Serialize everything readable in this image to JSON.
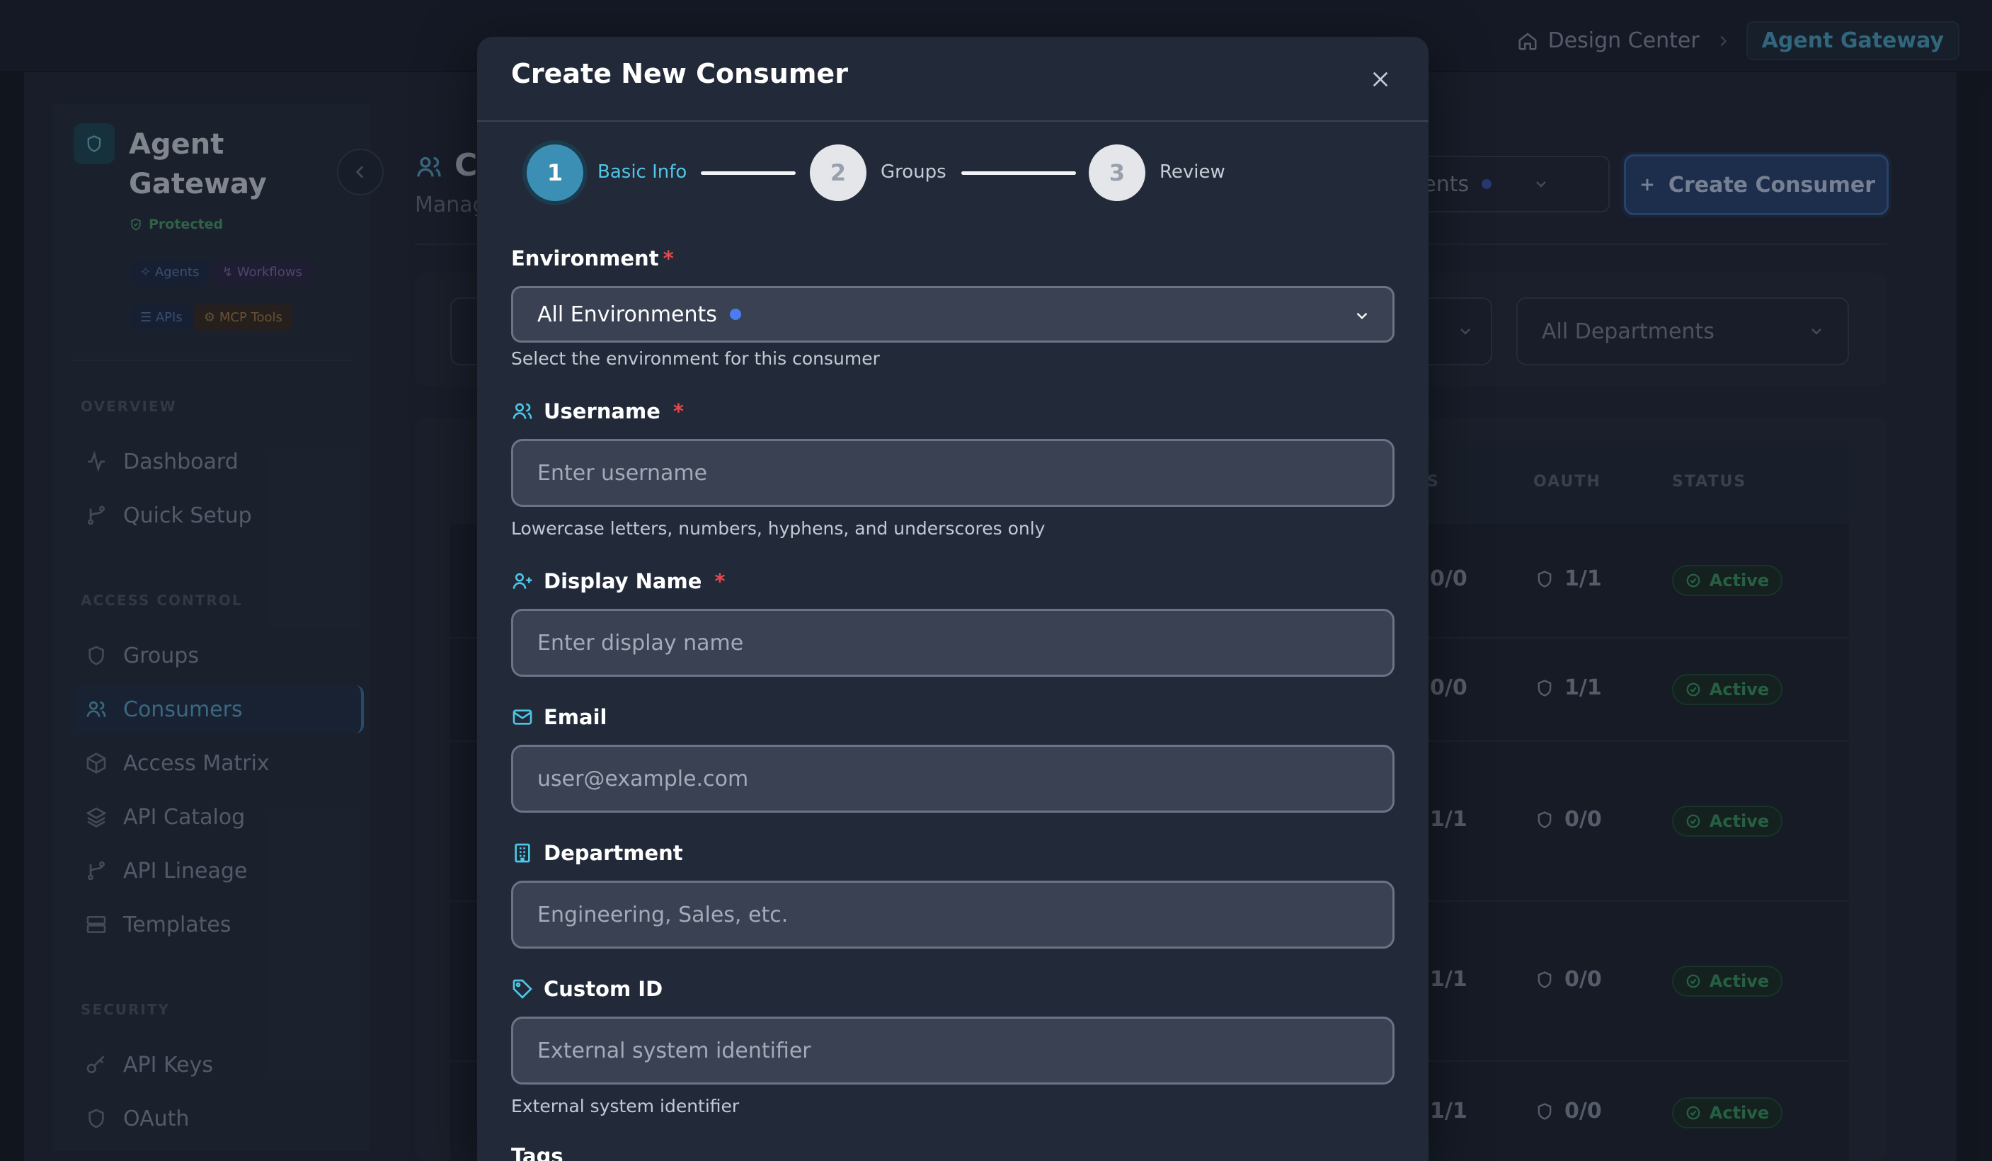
{
  "breadcrumb": {
    "home": "Design Center",
    "current": "Agent Gateway"
  },
  "brand": {
    "title": "Agent Gateway",
    "badge": "Protected",
    "tags": [
      "Agents",
      "Workflows",
      "APIs",
      "MCP Tools"
    ]
  },
  "sidebar": {
    "sections": [
      {
        "title": "OVERVIEW",
        "items": [
          "Dashboard",
          "Quick Setup"
        ]
      },
      {
        "title": "ACCESS CONTROL",
        "items": [
          "Groups",
          "Consumers",
          "Access Matrix",
          "API Catalog",
          "API Lineage",
          "Templates"
        ]
      },
      {
        "title": "SECURITY",
        "items": [
          "API Keys",
          "OAuth"
        ]
      }
    ],
    "active_item": "Consumers"
  },
  "page": {
    "title_fragment": "C",
    "subtitle_fragment": "Manag",
    "env_filter_fragment": "nments",
    "create_button": "Create Consumer",
    "department_filter": "All Departments"
  },
  "table": {
    "headers": {
      "h1": "S",
      "oauth": "OAUTH",
      "status": "STATUS"
    },
    "rows": [
      {
        "a": "0/0",
        "oauth": "1/1",
        "status": "Active"
      },
      {
        "a": "0/0",
        "oauth": "1/1",
        "status": "Active"
      },
      {
        "a": "1/1",
        "oauth": "0/0",
        "status": "Active"
      },
      {
        "a": "1/1",
        "oauth": "0/0",
        "status": "Active"
      },
      {
        "a": "1/1",
        "oauth": "0/0",
        "status": "Active"
      }
    ]
  },
  "modal": {
    "title": "Create New Consumer",
    "steps": [
      {
        "number": "1",
        "label": "Basic Info",
        "state": "active"
      },
      {
        "number": "2",
        "label": "Groups",
        "state": "inactive"
      },
      {
        "number": "3",
        "label": "Review",
        "state": "inactive"
      }
    ],
    "environment": {
      "label": "Environment",
      "required": "*",
      "value": "All Environments",
      "help": "Select the environment for this consumer"
    },
    "username": {
      "label": "Username",
      "required": "*",
      "placeholder": "Enter username",
      "value": "",
      "help": "Lowercase letters, numbers, hyphens, and underscores only"
    },
    "display_name": {
      "label": "Display Name",
      "required": "*",
      "placeholder": "Enter display name",
      "value": ""
    },
    "email": {
      "label": "Email",
      "placeholder": "user@example.com",
      "value": ""
    },
    "department": {
      "label": "Department",
      "placeholder": "Engineering, Sales, etc.",
      "value": ""
    },
    "custom_id": {
      "label": "Custom ID",
      "placeholder": "External system identifier",
      "value": "",
      "help": "External system identifier"
    },
    "tags_label": "Tags"
  },
  "colors": {
    "accent": "#3b8fb4",
    "active_step_text": "#4ec6e6",
    "required": "#e5484d",
    "status_active": "#3c9d66"
  }
}
